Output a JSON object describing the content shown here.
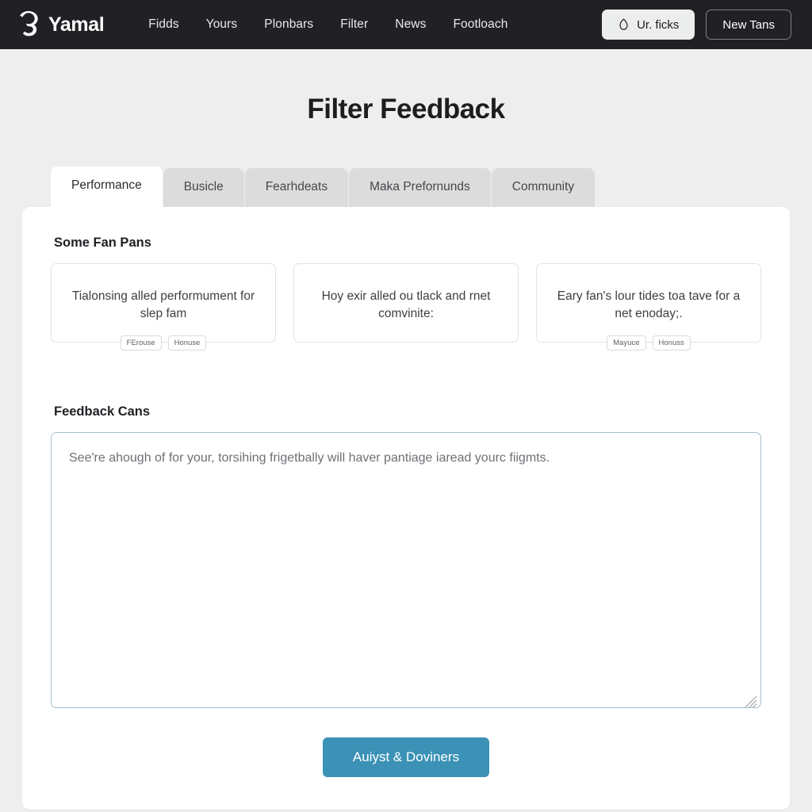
{
  "header": {
    "brand": "Yamal",
    "brand_icon": "spiral-logo-icon",
    "nav": [
      {
        "label": "Fidds"
      },
      {
        "label": "Yours"
      },
      {
        "label": "Plonbars"
      },
      {
        "label": "Filter"
      },
      {
        "label": "News"
      },
      {
        "label": "Footloach"
      }
    ],
    "primary_button": {
      "label": "Ur. ficks",
      "icon": "flame-icon"
    },
    "secondary_button": {
      "label": "New Tans"
    }
  },
  "main": {
    "title": "Filter Feedback",
    "tabs": [
      {
        "label": "Performance",
        "active": true
      },
      {
        "label": "Busicle",
        "active": false
      },
      {
        "label": "Fearhdeats",
        "active": false
      },
      {
        "label": "Maka Prefornunds",
        "active": false
      },
      {
        "label": "Community",
        "active": false
      }
    ],
    "suggestions": {
      "heading": "Some Fan Pans",
      "cards": [
        {
          "text": "Tialonsing alled performument for slep fam",
          "tags": [
            "FErouse",
            "Honuse"
          ]
        },
        {
          "text": "Hoy exir alled ou tlack and rnet comvinite:",
          "tags": []
        },
        {
          "text": "Eary fan's lour tides toa tave for a net enoday;.",
          "tags": [
            "Mayuce",
            "Honuss"
          ]
        }
      ]
    },
    "feedback": {
      "heading": "Feedback Cans",
      "placeholder": "See're ahough of for your, torsihing frigetbally will haver pantiage iaread yourc fiigmts.",
      "value": "",
      "submit_label": "Auiyst & Doviners"
    }
  },
  "colors": {
    "header_bg": "#212125",
    "page_bg": "#eeeeee",
    "panel_bg": "#ffffff",
    "accent": "#3b92b6",
    "tab_inactive": "#dcdcdc",
    "textarea_border": "#a9bfcc"
  }
}
